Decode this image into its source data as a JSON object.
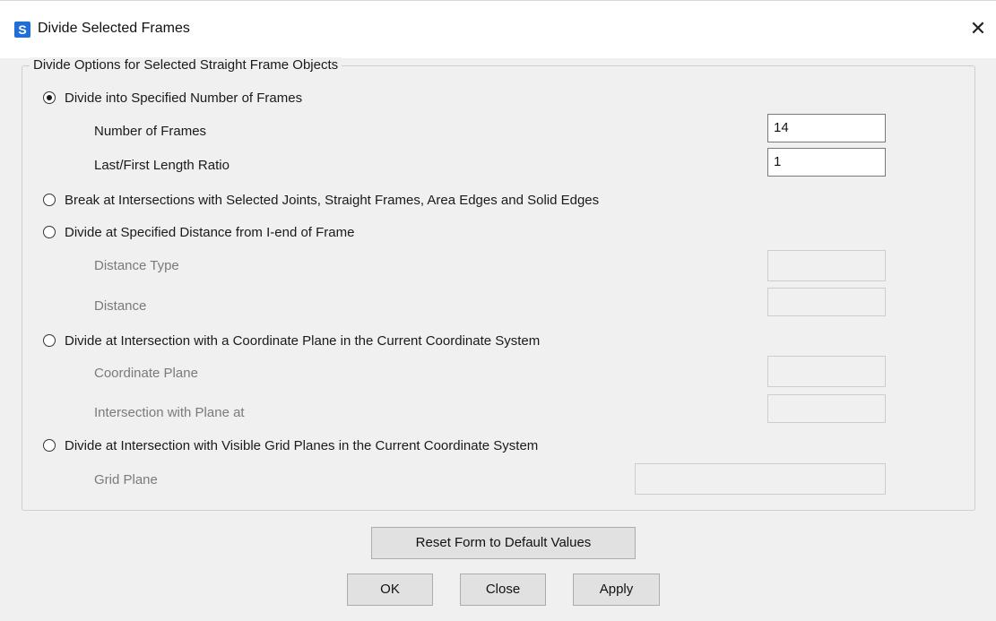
{
  "window": {
    "app_icon_letter": "S",
    "title": "Divide Selected Frames",
    "close_glyph": "✕"
  },
  "group": {
    "legend": "Divide Options for Selected Straight Frame Objects"
  },
  "options": {
    "specified_number": {
      "label": "Divide into Specified Number of Frames",
      "selected": true,
      "number_of_frames_label": "Number of Frames",
      "number_of_frames_value": "14",
      "length_ratio_label": "Last/First Length Ratio",
      "length_ratio_value": "1"
    },
    "break_intersections": {
      "label": "Break at Intersections with Selected Joints, Straight Frames, Area Edges and Solid Edges",
      "selected": false
    },
    "specified_distance": {
      "label": "Divide at Specified Distance from I-end of Frame",
      "selected": false,
      "distance_type_label": "Distance Type",
      "distance_type_value": "",
      "distance_label": "Distance",
      "distance_value": ""
    },
    "coordinate_plane": {
      "label": "Divide at Intersection with a Coordinate Plane in the Current Coordinate System",
      "selected": false,
      "plane_label": "Coordinate Plane",
      "plane_value": "",
      "intersection_label": "Intersection with Plane at",
      "intersection_value": ""
    },
    "grid_planes": {
      "label": "Divide at Intersection with Visible Grid Planes in the Current Coordinate System",
      "selected": false,
      "grid_plane_label": "Grid Plane",
      "grid_plane_value": ""
    }
  },
  "buttons": {
    "reset": "Reset Form to Default Values",
    "ok": "OK",
    "close": "Close",
    "apply": "Apply"
  },
  "colors": {
    "dialog_bg": "#f0f0f0",
    "title_bg": "#ffffff",
    "app_icon": "#1f6fd6",
    "disabled_text": "#7a7a7a",
    "button_bg": "#e1e1e1"
  }
}
